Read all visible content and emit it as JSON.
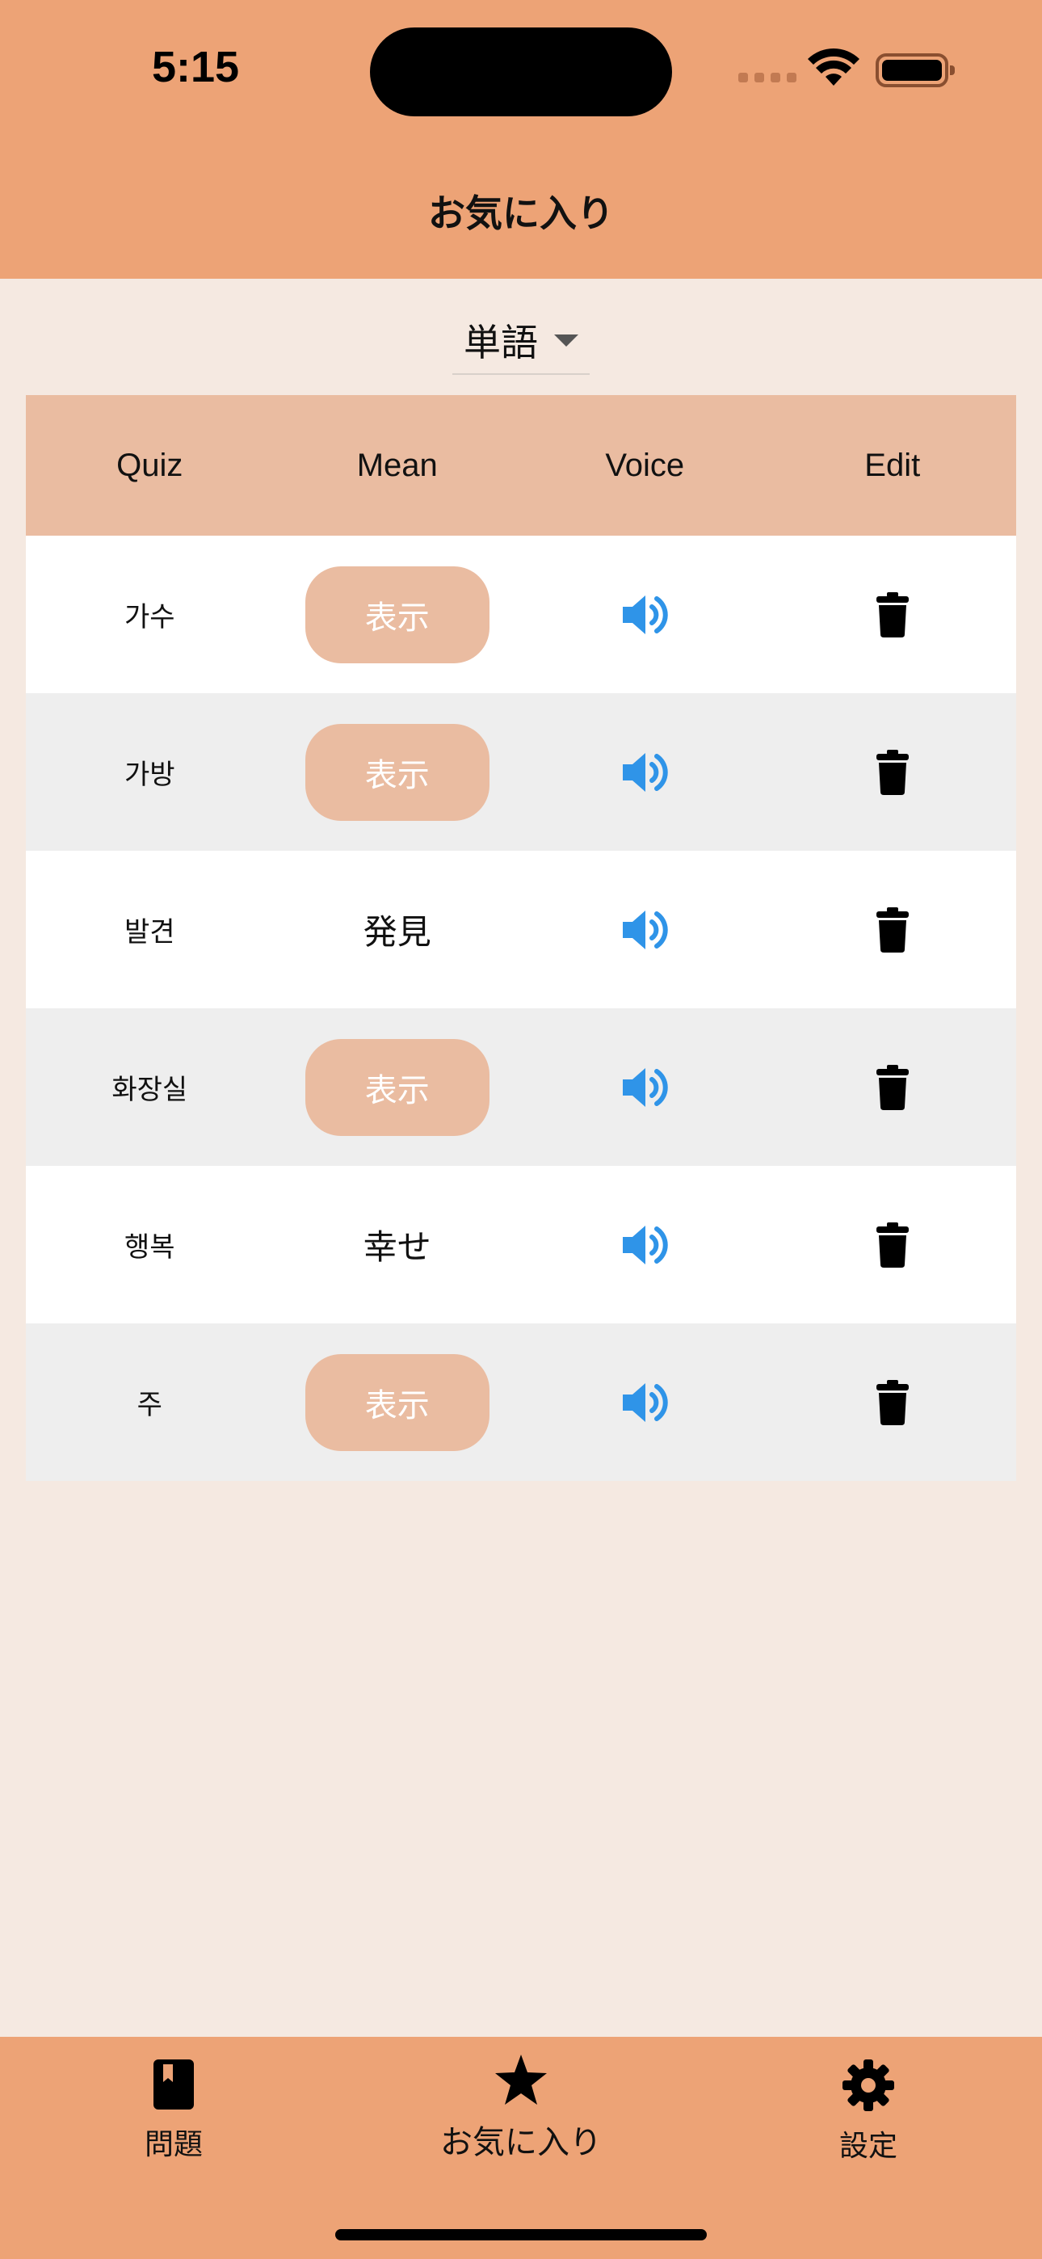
{
  "status_bar": {
    "time": "5:15"
  },
  "header": {
    "title": "お気に入り"
  },
  "selector": {
    "value": "単語"
  },
  "table": {
    "columns": [
      "Quiz",
      "Mean",
      "Voice",
      "Edit"
    ],
    "rows": [
      {
        "quiz": "가수",
        "mean": "表示",
        "mean_revealed": false
      },
      {
        "quiz": "가방",
        "mean": "表示",
        "mean_revealed": false
      },
      {
        "quiz": "발견",
        "mean": "発見",
        "mean_revealed": true
      },
      {
        "quiz": "화장실",
        "mean": "表示",
        "mean_revealed": false
      },
      {
        "quiz": "행복",
        "mean": "幸せ",
        "mean_revealed": true
      },
      {
        "quiz": "주",
        "mean": "表示",
        "mean_revealed": false
      }
    ],
    "voice_icon": "speaker-icon",
    "edit_icon": "trash-icon"
  },
  "bottom_nav": {
    "items": [
      {
        "label": "問題",
        "icon": "book-icon"
      },
      {
        "label": "お気に入り",
        "icon": "star-icon",
        "active": true
      },
      {
        "label": "設定",
        "icon": "gear-icon"
      }
    ]
  },
  "colors": {
    "header_bg": "#eda376",
    "page_bg": "#f5e9e1",
    "table_header_bg": "#eabca1",
    "show_button_bg": "#eabca1",
    "speaker_blue": "#2f94e8"
  }
}
